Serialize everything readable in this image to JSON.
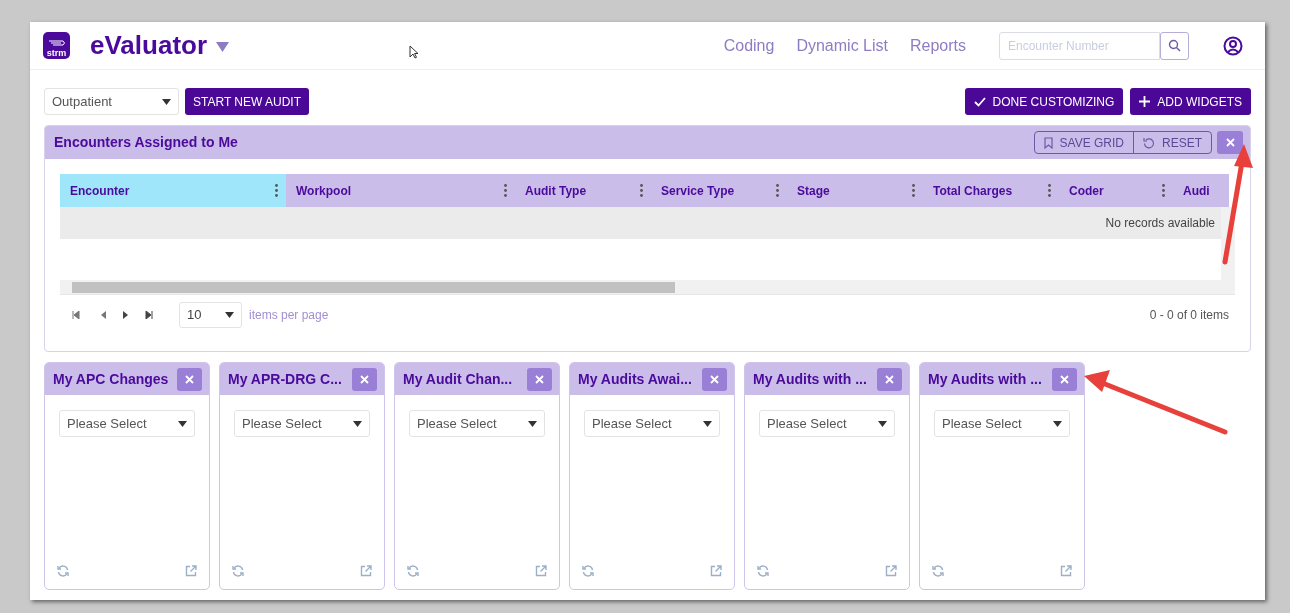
{
  "header": {
    "logo_text": "strm",
    "app_name": "eValuator",
    "nav": [
      {
        "label": "Coding"
      },
      {
        "label": "Dynamic List"
      },
      {
        "label": "Reports"
      }
    ],
    "search": {
      "placeholder": "Encounter Number"
    }
  },
  "toolbar": {
    "patient_type": "Outpatient",
    "start_button": "START NEW AUDIT",
    "buttons": [
      {
        "kind": "done",
        "label": "DONE CUSTOMIZING"
      },
      {
        "kind": "add",
        "label": "ADD WIDGETS"
      }
    ]
  },
  "grid_panel": {
    "title": "Encounters Assigned to Me",
    "actions": [
      {
        "kind": "save",
        "label": "SAVE GRID"
      },
      {
        "kind": "reset",
        "label": "RESET"
      }
    ],
    "columns": [
      {
        "label": "Encounter",
        "selected": true
      },
      {
        "label": "Workpool",
        "selected": false
      },
      {
        "label": "Audit Type",
        "selected": false
      },
      {
        "label": "Service Type",
        "selected": false
      },
      {
        "label": "Stage",
        "selected": false
      },
      {
        "label": "Total Charges",
        "selected": false
      },
      {
        "label": "Coder",
        "selected": false
      },
      {
        "label": "Audi",
        "selected": false
      }
    ],
    "empty_message": "No records available",
    "page_size": "10",
    "page_size_label": "items per page",
    "pager_info": "0 - 0 of 0 items"
  },
  "widgets": [
    {
      "title": "My APC Changes",
      "placeholder": "Please Select"
    },
    {
      "title": "My APR-DRG C...",
      "placeholder": "Please Select"
    },
    {
      "title": "My Audit Chan...",
      "placeholder": "Please Select"
    },
    {
      "title": "My Audits Awai...",
      "placeholder": "Please Select"
    },
    {
      "title": "My Audits with ...",
      "placeholder": "Please Select"
    },
    {
      "title": "My Audits with ...",
      "placeholder": "Please Select"
    }
  ]
}
